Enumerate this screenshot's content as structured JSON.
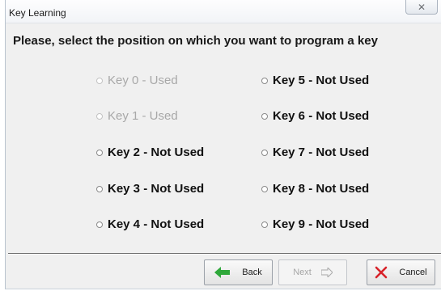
{
  "window": {
    "title": "Key Learning",
    "close_glyph": "✕"
  },
  "heading": "Please, select the position on which you want to program a key",
  "keys": [
    {
      "label": "Key 0 - Used",
      "enabled": false
    },
    {
      "label": "Key 1 - Used",
      "enabled": false
    },
    {
      "label": "Key 2 - Not Used",
      "enabled": true
    },
    {
      "label": "Key 3 - Not Used",
      "enabled": true
    },
    {
      "label": "Key 4 - Not Used",
      "enabled": true
    },
    {
      "label": "Key 5 - Not Used",
      "enabled": true
    },
    {
      "label": "Key 6 - Not Used",
      "enabled": true
    },
    {
      "label": "Key 7 - Not Used",
      "enabled": true
    },
    {
      "label": "Key 8 - Not Used",
      "enabled": true
    },
    {
      "label": "Key 9 - Not Used",
      "enabled": true
    }
  ],
  "buttons": {
    "back": {
      "label": "Back",
      "icon": "green-arrow-left-icon",
      "color": "#2fa83a",
      "enabled": true
    },
    "next": {
      "label": "Next",
      "icon": "arrow-right-icon",
      "enabled": false
    },
    "cancel": {
      "label": "Cancel",
      "icon": "red-x-icon",
      "color": "#d8232a",
      "enabled": true
    }
  }
}
